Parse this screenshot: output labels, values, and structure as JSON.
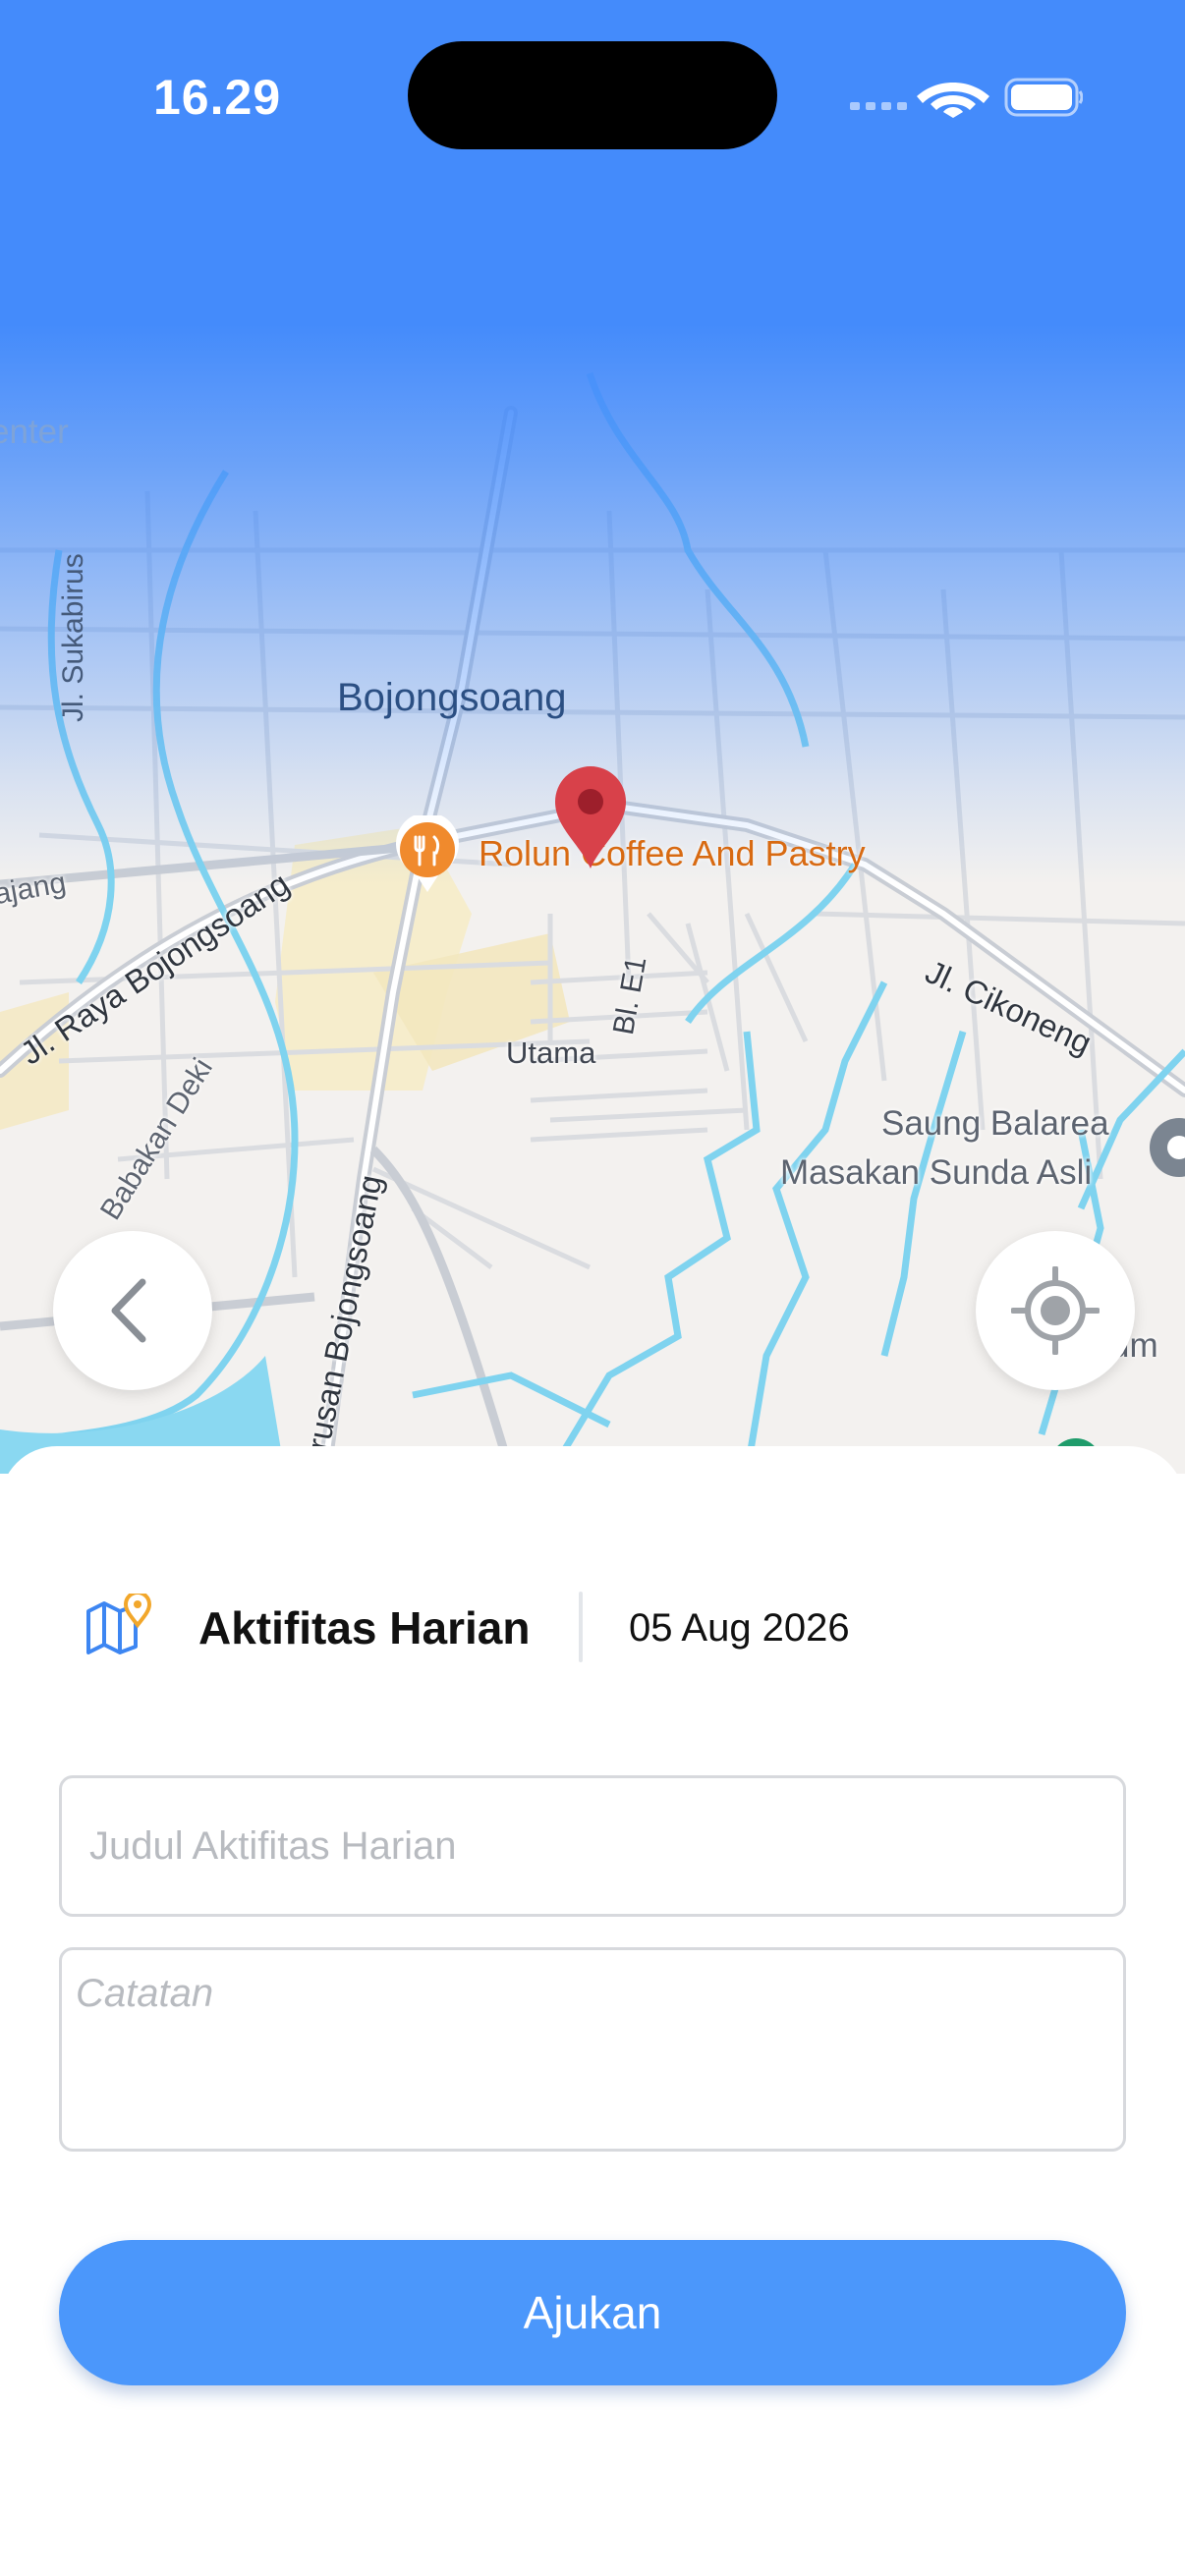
{
  "status_bar": {
    "time": "16.29"
  },
  "map": {
    "place_labels": {
      "area": "Bojongsoang",
      "poi": "Rolun Coffee And Pastry",
      "saung_line1": "Saung Balarea",
      "saung_line2": "Masakan Sunda Asli",
      "utama": "Utama",
      "blok": "Bl. E1",
      "partial_left": "ajang",
      "partial_right": "um",
      "partial_top": "enter"
    },
    "road_labels": {
      "sukabirus": "Jl. Sukabirus",
      "raya_bojongsoang": "Jl. Raya Bojongsoang",
      "babakan_deki": "Babakan Deki",
      "terusan": "rusan Bojongsoang",
      "cikoneng": "Jl. Cikoneng"
    },
    "colors": {
      "header_blue": "#448bfb",
      "pin_red": "#d8414a",
      "poi_orange": "#f08a2d",
      "water": "#7fd3ef"
    }
  },
  "sheet": {
    "title": "Aktifitas Harian",
    "date": "05 Aug 2026",
    "title_field": {
      "placeholder": "Judul Aktifitas Harian",
      "value": ""
    },
    "notes_field": {
      "placeholder": "Catatan",
      "value": ""
    },
    "submit_label": "Ajukan"
  },
  "icons": [
    "chevron-left-icon",
    "crosshair-icon",
    "map-pin-icon",
    "wifi-icon",
    "battery-icon",
    "cellular-icon"
  ]
}
